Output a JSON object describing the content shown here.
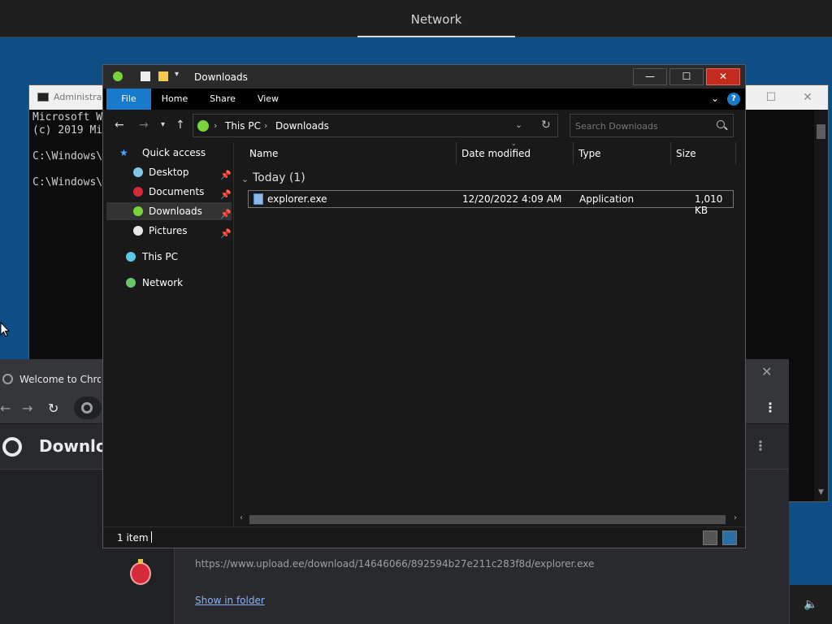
{
  "topbar": {
    "title": "Network"
  },
  "console": {
    "title": "Administrat",
    "lines": [
      "Microsoft W",
      "(c) 2019 Mi",
      "",
      "C:\\Windows\\",
      "",
      "C:\\Windows\\"
    ]
  },
  "chrome": {
    "tab_title": "Welcome to Chrom",
    "page_heading": "Downlo",
    "download_url": "https://www.upload.ee/download/14646066/892594b27e211c283f8d/explorer.exe",
    "show_in_folder": "Show in folder"
  },
  "explorer": {
    "title": "Downloads",
    "ribbon_tabs": [
      "File",
      "Home",
      "Share",
      "View"
    ],
    "breadcrumb": [
      "This PC",
      "Downloads"
    ],
    "search_placeholder": "Search Downloads",
    "nav": {
      "quick_access": "Quick access",
      "desktop": "Desktop",
      "documents": "Documents",
      "downloads": "Downloads",
      "pictures": "Pictures",
      "this_pc": "This PC",
      "network": "Network"
    },
    "columns": {
      "name": "Name",
      "date": "Date modified",
      "type": "Type",
      "size": "Size"
    },
    "group": "Today (1)",
    "files": [
      {
        "name": "explorer.exe",
        "date": "12/20/2022 4:09 AM",
        "type": "Application",
        "size": "1,010 KB"
      }
    ],
    "status": "1 item"
  },
  "colors": {
    "accent": "#1979ca",
    "close_red": "#c42b1c",
    "desktop": "#0e4d86"
  }
}
